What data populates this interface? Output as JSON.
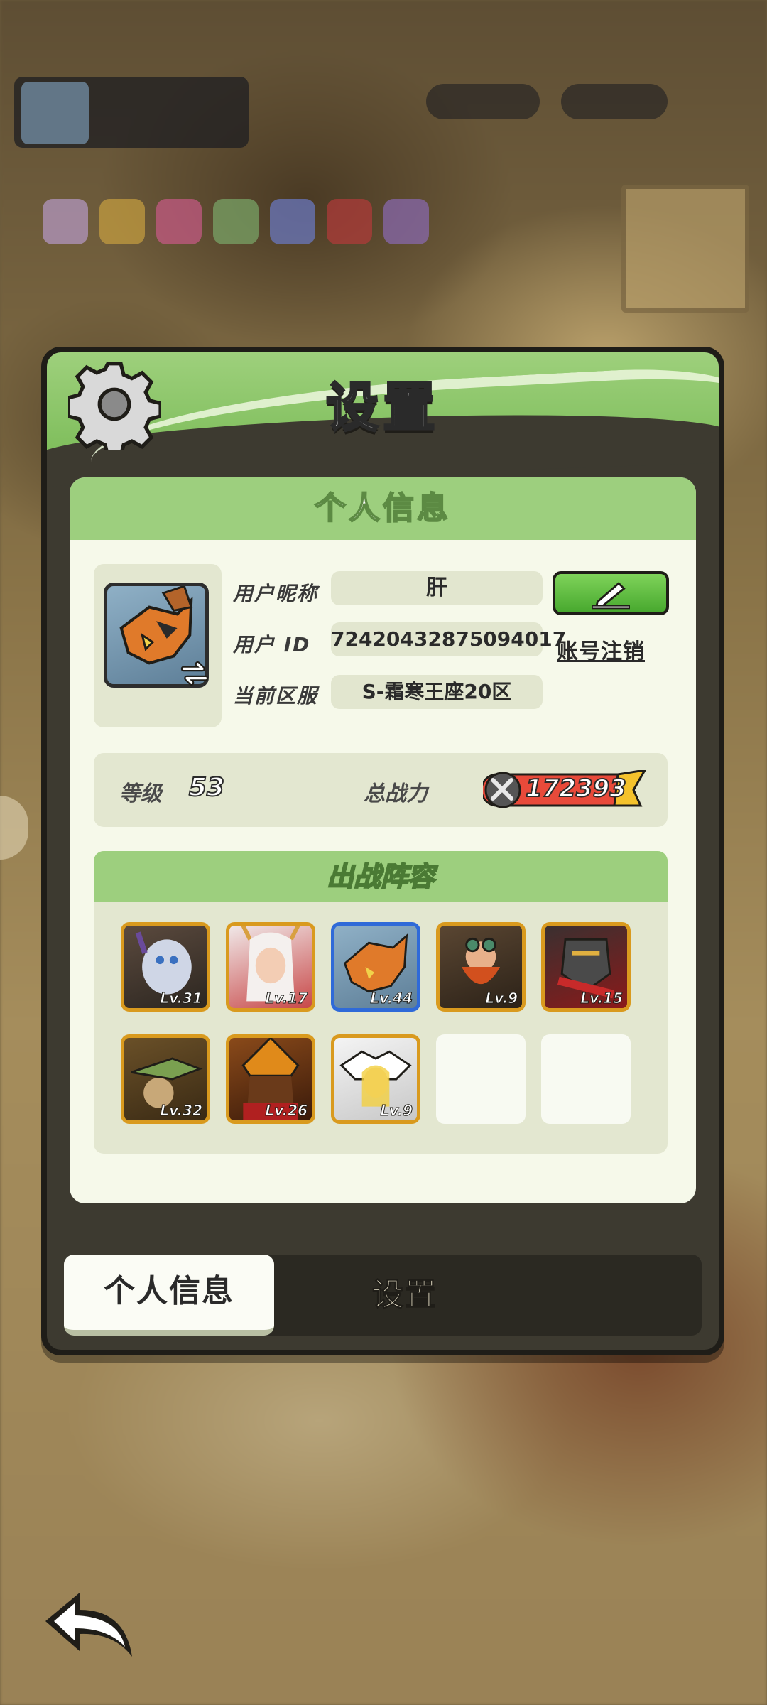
{
  "dialog": {
    "title": "设置"
  },
  "section": {
    "header": "个人信息"
  },
  "profile": {
    "nickname_label": "用户昵称",
    "nickname": "肝",
    "id_label": "用户 ID",
    "user_id": "72420432875094017",
    "server_label": "当前区服",
    "server": "S-霜寒王座20区",
    "account_cancel_label": "账号注销"
  },
  "stats": {
    "level_label": "等级",
    "level": "53",
    "power_label": "总战力",
    "power": "172393"
  },
  "lineup": {
    "header": "出战阵容",
    "heroes": [
      {
        "lv": "Lv.31"
      },
      {
        "lv": "Lv.17"
      },
      {
        "lv": "Lv.44"
      },
      {
        "lv": "Lv.9"
      },
      {
        "lv": "Lv.15"
      },
      {
        "lv": "Lv.32"
      },
      {
        "lv": "Lv.26"
      },
      {
        "lv": "Lv.9"
      }
    ]
  },
  "tabs": {
    "active": "个人信息",
    "other": "设置"
  },
  "colors": {
    "accent_green": "#9dcf7e",
    "panel_dark": "#3d3a30",
    "card_light": "#f6f9ea",
    "border_gold": "#d99a1e",
    "border_blue": "#2f6ad8"
  }
}
